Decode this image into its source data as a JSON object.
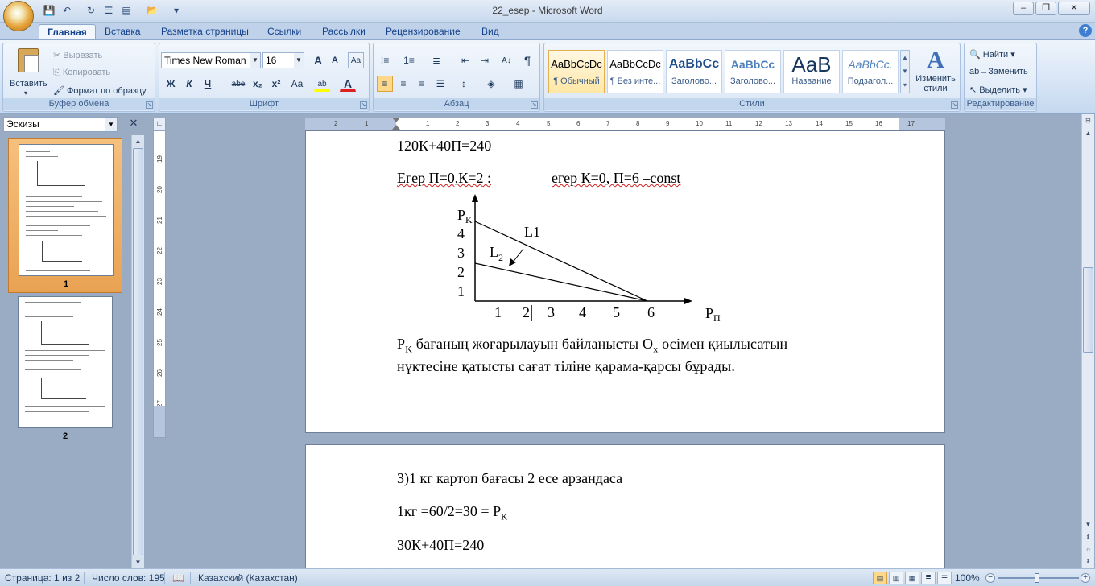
{
  "window": {
    "title": "22_esep - Microsoft Word",
    "minimize": "–",
    "maximize": "❐",
    "close": "✕",
    "help": "?"
  },
  "quick_access": {
    "save": "💾",
    "undo": "↶",
    "redo": "↻",
    "customize": "▾"
  },
  "tabs": [
    "Главная",
    "Вставка",
    "Разметка страницы",
    "Ссылки",
    "Рассылки",
    "Рецензирование",
    "Вид"
  ],
  "active_tab": "Главная",
  "ribbon": {
    "clipboard": {
      "label": "Буфер обмена",
      "paste": "Вставить",
      "cut": "Вырезать",
      "copy": "Копировать",
      "format_painter": "Формат по образцу"
    },
    "font": {
      "label": "Шрифт",
      "font_name": "Times New Roman",
      "font_size": "16",
      "grow": "A",
      "shrink": "A",
      "clear": "Aa",
      "bold": "Ж",
      "italic": "К",
      "underline": "Ч",
      "strike": "abe",
      "subscript": "x₂",
      "superscript": "x²",
      "case": "Aa",
      "highlight": "ab",
      "color": "A"
    },
    "paragraph": {
      "label": "Абзац",
      "pilcrow": "¶",
      "sort": "A↓"
    },
    "styles": {
      "label": "Стили",
      "items": [
        {
          "sample": "AaBbCcDc",
          "name": "¶ Обычный"
        },
        {
          "sample": "AaBbCcDc",
          "name": "¶ Без инте..."
        },
        {
          "sample": "AaBbCc",
          "name": "Заголово..."
        },
        {
          "sample": "AaBbCc",
          "name": "Заголово..."
        },
        {
          "sample": "AaB",
          "name": "Название"
        },
        {
          "sample": "AaBbCc.",
          "name": "Подзагол..."
        }
      ],
      "change_styles": "Изменить стили"
    },
    "editing": {
      "label": "Редактирование",
      "find": "Найти",
      "replace": "Заменить",
      "select": "Выделить"
    }
  },
  "nav_pane": {
    "mode": "Эскизы",
    "pages": [
      "1",
      "2"
    ]
  },
  "ruler": {
    "h_ticks": [
      "2",
      "1",
      "1",
      "2",
      "3",
      "4",
      "5",
      "6",
      "7",
      "8",
      "9",
      "10",
      "11",
      "12",
      "13",
      "14",
      "15",
      "16",
      "17"
    ],
    "v_ticks": [
      "19",
      "20",
      "21",
      "22",
      "23",
      "24",
      "25",
      "26",
      "27"
    ]
  },
  "document": {
    "line1": "120К+40П=240",
    "line2_part1": "Егер П=0,К=2 :",
    "line2_part2": "егер К=0,  П=6 –const",
    "chart": {
      "y_axis_label_main": "P",
      "y_axis_label_sub": "K",
      "x_axis_label_main": "P",
      "x_axis_label_sub": "П",
      "y_ticks": [
        "4",
        "3",
        "2",
        "1"
      ],
      "x_ticks": [
        "1",
        "2",
        "3",
        "4",
        "5",
        "6"
      ],
      "line1_label": "L1",
      "line2_label_main": "L",
      "line2_label_sub": "2"
    },
    "para1_main": "P",
    "para1_sub": "K",
    "para1_rest": " бағаның жоғарылауын байланысты О",
    "para1_sub2": "х",
    "para1_end": " осімен қиылысатын",
    "para1_line2": "нүктесіне қатысты сағат тіліне қарама-қарсы  бұрады.",
    "page2_line1": "3)1 кг картоп бағасы 2 есе арзандаса",
    "page2_line2_main": "1кг  =60/2=30 = Р",
    "page2_line2_sub": "К",
    "page2_line3": "30К+40П=240"
  },
  "status_bar": {
    "page": "Страница: 1 из 2",
    "words": "Число слов: 195",
    "language": "Казахский (Казахстан)",
    "zoom": "100%"
  }
}
